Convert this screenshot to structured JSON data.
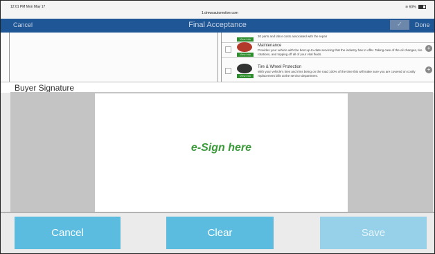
{
  "statusbar": {
    "time": "12:01 PM  Mon May 17",
    "url": "1.drewsautomotive.com",
    "battery": "60%"
  },
  "navbar": {
    "cancel_label": "Cancel",
    "title": "Final Acceptance",
    "done_label": "Done",
    "check_icon": "check-icon"
  },
  "background_list": {
    "items": [
      {
        "title": "",
        "desc": "30 parts and labor costs associated with the repair",
        "viewinfo": "View info"
      },
      {
        "title": "Maintenance",
        "desc": "Provides your vehicle with the best up-to-date servicing that the industry has to offer. Taking care of the oil changes, tire rotations, and topping off all of your vital fluids.",
        "viewinfo": "View info"
      },
      {
        "title": "Tire & Wheel Protection",
        "desc": "With your vehicle's tires and rims being on the road 100% of the time this will make sure you are covered on costly replacement bills at the service department.",
        "viewinfo": "View info"
      }
    ]
  },
  "signature": {
    "header": "Buyer Signature",
    "hint": "e-Sign here"
  },
  "buttons": {
    "cancel": "Cancel",
    "clear": "Clear",
    "save": "Save"
  },
  "colors": {
    "navbar": "#1f5796",
    "button": "#5bbcdf",
    "button_disabled": "#97d1e9",
    "hint": "#3a9a3a"
  }
}
